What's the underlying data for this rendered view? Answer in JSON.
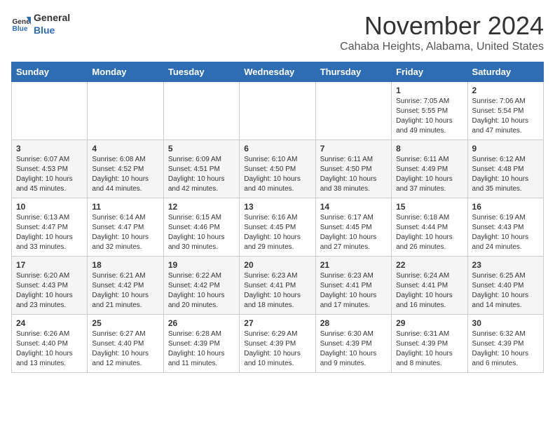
{
  "logo": {
    "line1": "General",
    "line2": "Blue"
  },
  "title": "November 2024",
  "location": "Cahaba Heights, Alabama, United States",
  "weekdays": [
    "Sunday",
    "Monday",
    "Tuesday",
    "Wednesday",
    "Thursday",
    "Friday",
    "Saturday"
  ],
  "weeks": [
    [
      {
        "day": "",
        "info": ""
      },
      {
        "day": "",
        "info": ""
      },
      {
        "day": "",
        "info": ""
      },
      {
        "day": "",
        "info": ""
      },
      {
        "day": "",
        "info": ""
      },
      {
        "day": "1",
        "info": "Sunrise: 7:05 AM\nSunset: 5:55 PM\nDaylight: 10 hours and 49 minutes."
      },
      {
        "day": "2",
        "info": "Sunrise: 7:06 AM\nSunset: 5:54 PM\nDaylight: 10 hours and 47 minutes."
      }
    ],
    [
      {
        "day": "3",
        "info": "Sunrise: 6:07 AM\nSunset: 4:53 PM\nDaylight: 10 hours and 45 minutes."
      },
      {
        "day": "4",
        "info": "Sunrise: 6:08 AM\nSunset: 4:52 PM\nDaylight: 10 hours and 44 minutes."
      },
      {
        "day": "5",
        "info": "Sunrise: 6:09 AM\nSunset: 4:51 PM\nDaylight: 10 hours and 42 minutes."
      },
      {
        "day": "6",
        "info": "Sunrise: 6:10 AM\nSunset: 4:50 PM\nDaylight: 10 hours and 40 minutes."
      },
      {
        "day": "7",
        "info": "Sunrise: 6:11 AM\nSunset: 4:50 PM\nDaylight: 10 hours and 38 minutes."
      },
      {
        "day": "8",
        "info": "Sunrise: 6:11 AM\nSunset: 4:49 PM\nDaylight: 10 hours and 37 minutes."
      },
      {
        "day": "9",
        "info": "Sunrise: 6:12 AM\nSunset: 4:48 PM\nDaylight: 10 hours and 35 minutes."
      }
    ],
    [
      {
        "day": "10",
        "info": "Sunrise: 6:13 AM\nSunset: 4:47 PM\nDaylight: 10 hours and 33 minutes."
      },
      {
        "day": "11",
        "info": "Sunrise: 6:14 AM\nSunset: 4:47 PM\nDaylight: 10 hours and 32 minutes."
      },
      {
        "day": "12",
        "info": "Sunrise: 6:15 AM\nSunset: 4:46 PM\nDaylight: 10 hours and 30 minutes."
      },
      {
        "day": "13",
        "info": "Sunrise: 6:16 AM\nSunset: 4:45 PM\nDaylight: 10 hours and 29 minutes."
      },
      {
        "day": "14",
        "info": "Sunrise: 6:17 AM\nSunset: 4:45 PM\nDaylight: 10 hours and 27 minutes."
      },
      {
        "day": "15",
        "info": "Sunrise: 6:18 AM\nSunset: 4:44 PM\nDaylight: 10 hours and 26 minutes."
      },
      {
        "day": "16",
        "info": "Sunrise: 6:19 AM\nSunset: 4:43 PM\nDaylight: 10 hours and 24 minutes."
      }
    ],
    [
      {
        "day": "17",
        "info": "Sunrise: 6:20 AM\nSunset: 4:43 PM\nDaylight: 10 hours and 23 minutes."
      },
      {
        "day": "18",
        "info": "Sunrise: 6:21 AM\nSunset: 4:42 PM\nDaylight: 10 hours and 21 minutes."
      },
      {
        "day": "19",
        "info": "Sunrise: 6:22 AM\nSunset: 4:42 PM\nDaylight: 10 hours and 20 minutes."
      },
      {
        "day": "20",
        "info": "Sunrise: 6:23 AM\nSunset: 4:41 PM\nDaylight: 10 hours and 18 minutes."
      },
      {
        "day": "21",
        "info": "Sunrise: 6:23 AM\nSunset: 4:41 PM\nDaylight: 10 hours and 17 minutes."
      },
      {
        "day": "22",
        "info": "Sunrise: 6:24 AM\nSunset: 4:41 PM\nDaylight: 10 hours and 16 minutes."
      },
      {
        "day": "23",
        "info": "Sunrise: 6:25 AM\nSunset: 4:40 PM\nDaylight: 10 hours and 14 minutes."
      }
    ],
    [
      {
        "day": "24",
        "info": "Sunrise: 6:26 AM\nSunset: 4:40 PM\nDaylight: 10 hours and 13 minutes."
      },
      {
        "day": "25",
        "info": "Sunrise: 6:27 AM\nSunset: 4:40 PM\nDaylight: 10 hours and 12 minutes."
      },
      {
        "day": "26",
        "info": "Sunrise: 6:28 AM\nSunset: 4:39 PM\nDaylight: 10 hours and 11 minutes."
      },
      {
        "day": "27",
        "info": "Sunrise: 6:29 AM\nSunset: 4:39 PM\nDaylight: 10 hours and 10 minutes."
      },
      {
        "day": "28",
        "info": "Sunrise: 6:30 AM\nSunset: 4:39 PM\nDaylight: 10 hours and 9 minutes."
      },
      {
        "day": "29",
        "info": "Sunrise: 6:31 AM\nSunset: 4:39 PM\nDaylight: 10 hours and 8 minutes."
      },
      {
        "day": "30",
        "info": "Sunrise: 6:32 AM\nSunset: 4:39 PM\nDaylight: 10 hours and 6 minutes."
      }
    ]
  ]
}
